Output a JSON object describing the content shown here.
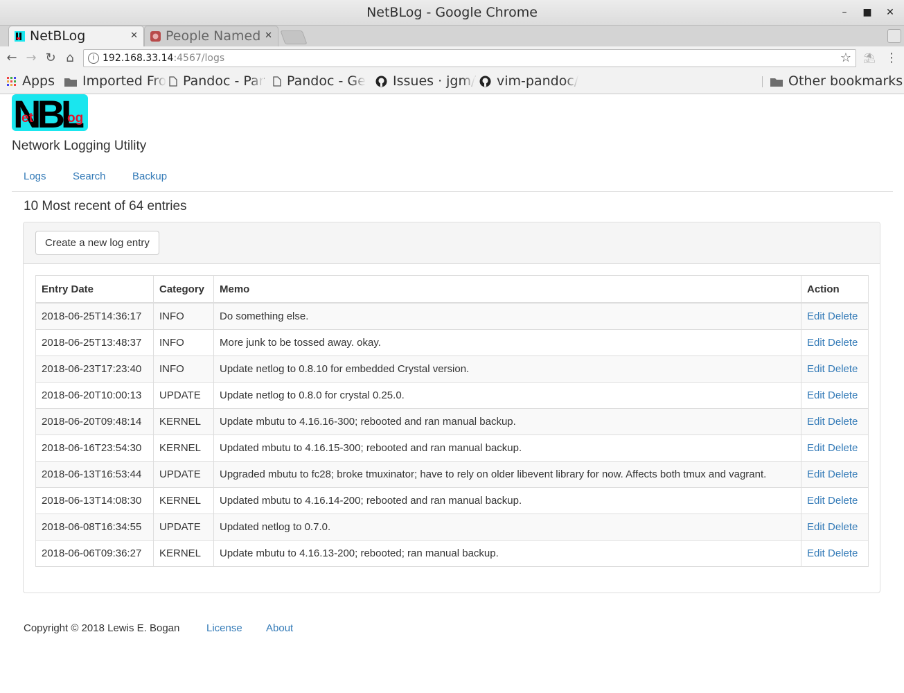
{
  "window": {
    "title": "NetBLog - Google Chrome"
  },
  "tabs": [
    {
      "label": "NetBLog",
      "active": true
    },
    {
      "label": "People Named",
      "active": false
    }
  ],
  "address": {
    "host": "192.168.33.14",
    "rest": ":4567/logs"
  },
  "bookmarks": [
    {
      "label": "Apps",
      "icon": "apps-grid-icon"
    },
    {
      "label": "Imported Fro",
      "icon": "folder-icon"
    },
    {
      "label": "Pandoc - Par",
      "icon": "page-icon"
    },
    {
      "label": "Pandoc - Ge",
      "icon": "page-icon"
    },
    {
      "label": "Issues · jgm/",
      "icon": "github-icon"
    },
    {
      "label": "vim-pandoc/",
      "icon": "github-icon"
    },
    {
      "label": "Other bookmarks",
      "icon": "folder-icon"
    }
  ],
  "brand": {
    "logo_big": "NBL",
    "logo_et": "et",
    "logo_og": "og",
    "subtitle": "Network Logging Utility",
    "logo_bg": "#1ae6ee"
  },
  "nav": {
    "logs": "Logs",
    "search": "Search",
    "backup": "Backup"
  },
  "heading": "10 Most recent of 64 entries",
  "create_button": "Create a new log entry",
  "table": {
    "headers": {
      "date": "Entry Date",
      "category": "Category",
      "memo": "Memo",
      "action": "Action"
    },
    "edit_label": "Edit",
    "delete_label": "Delete",
    "rows": [
      {
        "date": "2018-06-25T14:36:17",
        "category": "INFO",
        "memo": "Do something else."
      },
      {
        "date": "2018-06-25T13:48:37",
        "category": "INFO",
        "memo": "More junk to be tossed away. okay."
      },
      {
        "date": "2018-06-23T17:23:40",
        "category": "INFO",
        "memo": "Update netlog to 0.8.10 for embedded Crystal version."
      },
      {
        "date": "2018-06-20T10:00:13",
        "category": "UPDATE",
        "memo": "Update netlog to 0.8.0 for crystal 0.25.0."
      },
      {
        "date": "2018-06-20T09:48:14",
        "category": "KERNEL",
        "memo": "Update mbutu to 4.16.16-300; rebooted and ran manual backup."
      },
      {
        "date": "2018-06-16T23:54:30",
        "category": "KERNEL",
        "memo": "Updated mbutu to 4.16.15-300; rebooted and ran manual backup."
      },
      {
        "date": "2018-06-13T16:53:44",
        "category": "UPDATE",
        "memo": "Upgraded mbutu to fc28; broke tmuxinator; have to rely on older libevent library for now. Affects both tmux and vagrant."
      },
      {
        "date": "2018-06-13T14:08:30",
        "category": "KERNEL",
        "memo": "Updated mbutu to 4.16.14-200; rebooted and ran manual backup."
      },
      {
        "date": "2018-06-08T16:34:55",
        "category": "UPDATE",
        "memo": "Updated netlog to 0.7.0."
      },
      {
        "date": "2018-06-06T09:36:27",
        "category": "KERNEL",
        "memo": "Update mbutu to 4.16.13-200; rebooted; ran manual backup."
      }
    ]
  },
  "footer": {
    "copyright": "Copyright © 2018 Lewis E. Bogan",
    "license": "License",
    "about": "About"
  },
  "colors": {
    "link": "#337ab7",
    "text": "#333333"
  }
}
